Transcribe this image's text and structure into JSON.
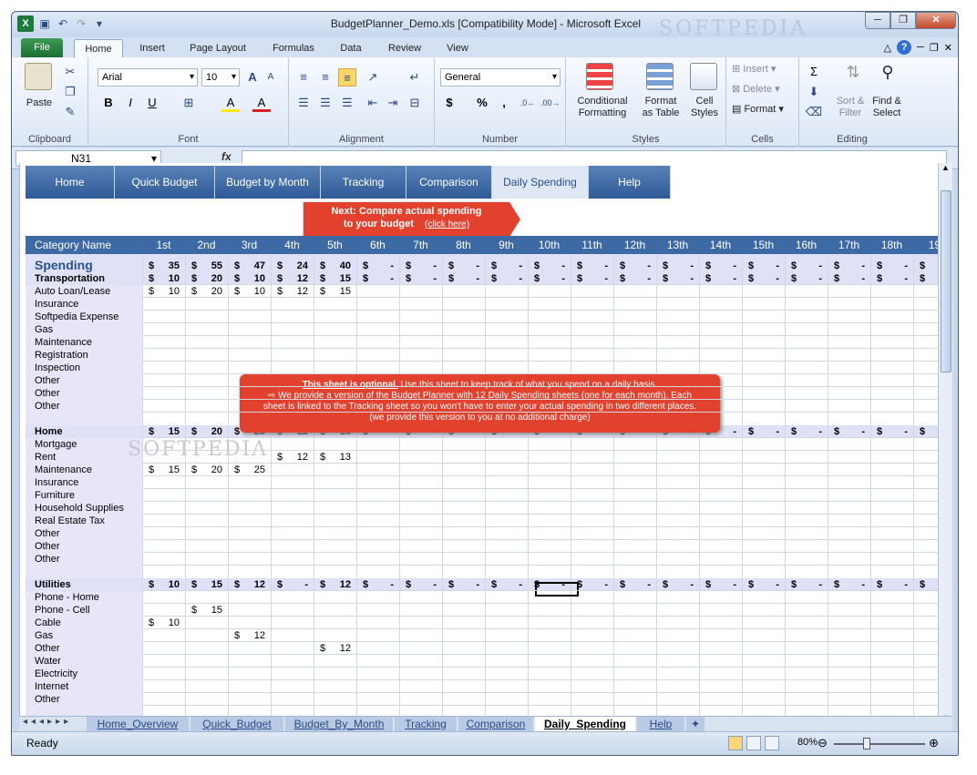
{
  "window": {
    "title": "BudgetPlanner_Demo.xls  [Compatibility Mode]  -  Microsoft Excel",
    "watermark": "SOFTPEDIA"
  },
  "ribbon": {
    "tabs": [
      "File",
      "Home",
      "Insert",
      "Page Layout",
      "Formulas",
      "Data",
      "Review",
      "View"
    ],
    "clipboard": {
      "paste": "Paste",
      "label": "Clipboard"
    },
    "font": {
      "name": "Arial",
      "size": "10",
      "label": "Font",
      "bold": "B",
      "italic": "I",
      "underline": "U",
      "grow": "A",
      "shrink": "A",
      "fill": "A",
      "color": "A"
    },
    "alignment": {
      "label": "Alignment"
    },
    "number": {
      "format": "General",
      "label": "Number",
      "currency": "$",
      "percent": "%",
      "comma": ","
    },
    "styles": {
      "cond": "Conditional",
      "cond2": "Formatting",
      "table": "Format",
      "table2": "as Table",
      "cell": "Cell",
      "cell2": "Styles",
      "label": "Styles"
    },
    "cells": {
      "insert": "Insert",
      "delete": "Delete",
      "format": "Format",
      "label": "Cells"
    },
    "editing": {
      "sigma": "Σ",
      "sort": "Sort &",
      "sort2": "Filter",
      "find": "Find &",
      "find2": "Select",
      "label": "Editing"
    }
  },
  "formula": {
    "namebox": "N31",
    "fx": "fx",
    "value": ""
  },
  "nav": {
    "buttons": [
      "Home",
      "Quick Budget",
      "Budget by Month",
      "Tracking",
      "Comparison",
      "Daily Spending",
      "Help"
    ],
    "active": 5
  },
  "callout": {
    "line1_bold": "Next:",
    "line1": " Compare actual spending",
    "line2": "to your budget",
    "link": "(click here)"
  },
  "header": {
    "category": "Category Name",
    "days": [
      "1st",
      "2nd",
      "3rd",
      "4th",
      "5th",
      "6th",
      "7th",
      "8th",
      "9th",
      "10th",
      "11th",
      "12th",
      "13th",
      "14th",
      "15th",
      "16th",
      "17th",
      "18th",
      "19"
    ]
  },
  "spending": {
    "label": "Spending",
    "totals": [
      "35",
      "55",
      "47",
      "24",
      "40",
      "-",
      "-",
      "-",
      "-",
      "-",
      "-",
      "-",
      "-",
      "-",
      "-",
      "-",
      "-",
      "-",
      "-"
    ]
  },
  "sections": [
    {
      "name": "Transportation",
      "totals": [
        "10",
        "20",
        "10",
        "12",
        "15",
        "-",
        "-",
        "-",
        "-",
        "-",
        "-",
        "-",
        "-",
        "-",
        "-",
        "-",
        "-",
        "-",
        "-"
      ],
      "items": [
        {
          "name": "Auto Loan/Lease",
          "vals": [
            "10",
            "20",
            "10",
            "12",
            "15"
          ]
        },
        {
          "name": "Insurance",
          "vals": []
        },
        {
          "name": "Softpedia Expense",
          "vals": []
        },
        {
          "name": "Gas",
          "vals": []
        },
        {
          "name": "Maintenance",
          "vals": []
        },
        {
          "name": "Registration",
          "vals": []
        },
        {
          "name": "Inspection",
          "vals": []
        },
        {
          "name": "Other",
          "vals": []
        },
        {
          "name": "Other",
          "vals": []
        },
        {
          "name": "Other",
          "vals": []
        }
      ]
    },
    {
      "name": "Home",
      "totals": [
        "15",
        "20",
        "25",
        "12",
        "13",
        "-",
        "-",
        "-",
        "-",
        "-",
        "-",
        "-",
        "-",
        "-",
        "-",
        "-",
        "-",
        "-",
        "-"
      ],
      "items": [
        {
          "name": "Mortgage",
          "vals": []
        },
        {
          "name": "Rent",
          "vals": [
            "",
            "",
            "",
            "12",
            "13"
          ]
        },
        {
          "name": "Maintenance",
          "vals": [
            "15",
            "20",
            "25"
          ]
        },
        {
          "name": "Insurance",
          "vals": []
        },
        {
          "name": "Furniture",
          "vals": []
        },
        {
          "name": "Household Supplies",
          "vals": []
        },
        {
          "name": "Real Estate Tax",
          "vals": []
        },
        {
          "name": "Other",
          "vals": []
        },
        {
          "name": "Other",
          "vals": []
        },
        {
          "name": "Other",
          "vals": []
        }
      ]
    },
    {
      "name": "Utilities",
      "totals": [
        "10",
        "15",
        "12",
        "-",
        "12",
        "-",
        "-",
        "-",
        "-",
        "-",
        "-",
        "-",
        "-",
        "-",
        "-",
        "-",
        "-",
        "-",
        "-"
      ],
      "items": [
        {
          "name": "Phone - Home",
          "vals": []
        },
        {
          "name": "Phone - Cell",
          "vals": [
            "",
            "15"
          ]
        },
        {
          "name": "Cable",
          "vals": [
            "10"
          ]
        },
        {
          "name": "Gas",
          "vals": [
            "",
            "",
            "12"
          ]
        },
        {
          "name": "Other",
          "vals": [
            "",
            "",
            "",
            "",
            "12"
          ]
        },
        {
          "name": "Water",
          "vals": []
        },
        {
          "name": "Electricity",
          "vals": []
        },
        {
          "name": "Internet",
          "vals": []
        },
        {
          "name": "Other",
          "vals": []
        }
      ]
    }
  ],
  "note": {
    "title": "This sheet is optional.",
    "line1": "  Use this sheet to keep track of what you spend on a daily basis.",
    "line2": "⇨ We provide a version of the Budget Planner  with 12 Daily Spending sheets (one for each month).  Each",
    "line3": "sheet is linked to the Tracking sheet so you won't have to enter your actual spending in two different places.",
    "line4": "(we provide this version to you at no additional charge)"
  },
  "sheet_tabs": [
    "Home_Overview",
    "Quick_Budget",
    "Budget_By_Month",
    "Tracking",
    "Comparison",
    "Daily_Spending",
    "Help"
  ],
  "active_sheet": "Daily_Spending",
  "status": {
    "ready": "Ready",
    "zoom": "80%"
  },
  "currency": "$"
}
